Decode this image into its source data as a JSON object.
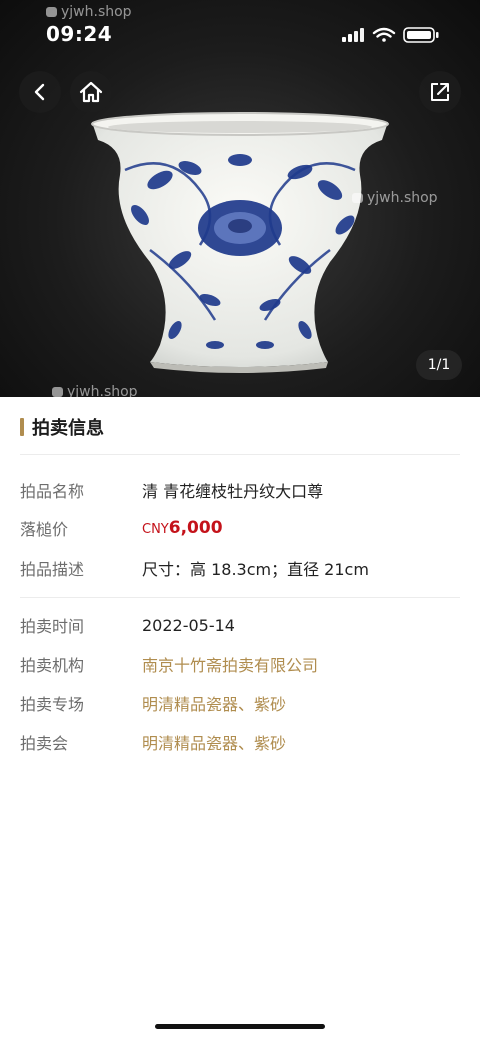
{
  "status": {
    "time": "09:24"
  },
  "gallery": {
    "counter": "1/1",
    "watermark": "yjwh.shop"
  },
  "section": {
    "title": "拍卖信息"
  },
  "details": {
    "name": {
      "label": "拍品名称",
      "value": "清 青花缠枝牡丹纹大口尊"
    },
    "price": {
      "label": "落槌价",
      "currency": "CNY",
      "amount": "6,000"
    },
    "description": {
      "label": "拍品描述",
      "value": "尺寸：高 18.3cm；直径 21cm"
    },
    "date": {
      "label": "拍卖时间",
      "value": "2022-05-14"
    },
    "house": {
      "label": "拍卖机构",
      "value": "南京十竹斋拍卖有限公司"
    },
    "session": {
      "label": "拍卖专场",
      "value": "明清精品瓷器、紫砂"
    },
    "sale": {
      "label": "拍卖会",
      "value": "明清精品瓷器、紫砂"
    }
  },
  "colors": {
    "accent": "#b08d4f",
    "price": "#c4121a"
  }
}
